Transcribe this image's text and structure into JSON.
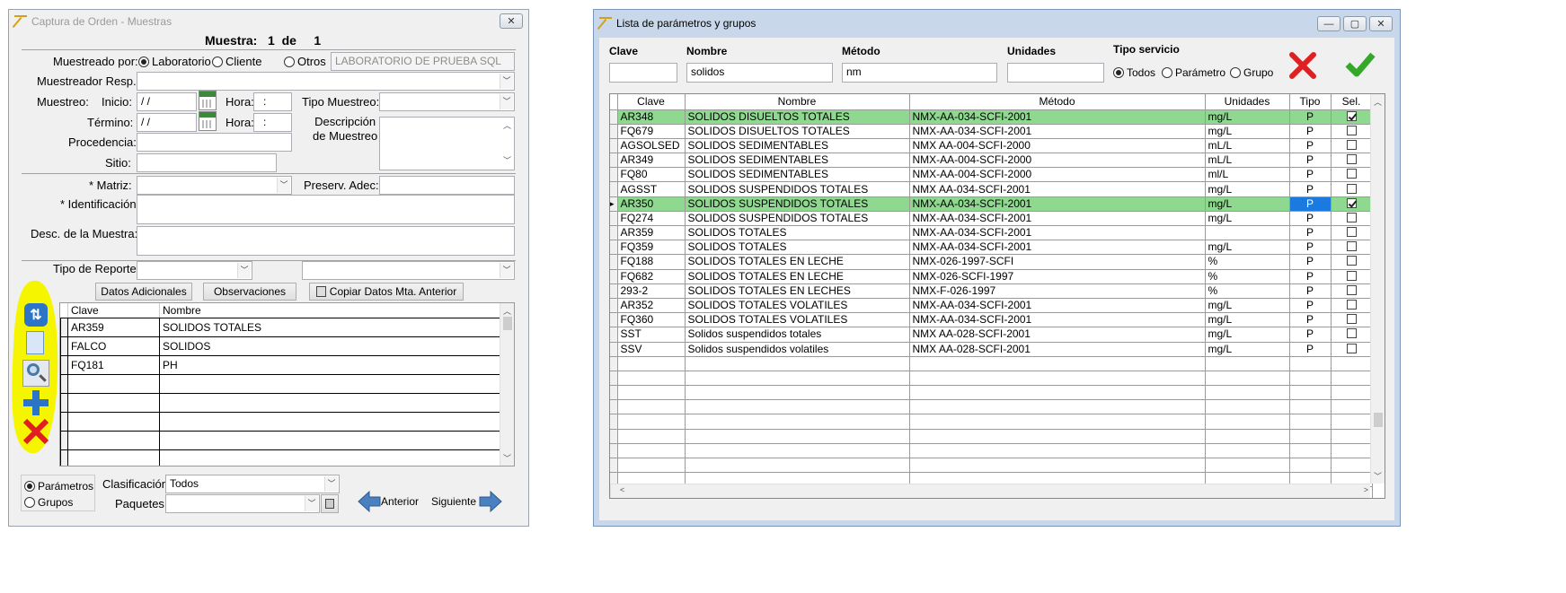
{
  "left": {
    "title": "Captura de Orden - Muestras",
    "muestra": {
      "label": "Muestra:",
      "num": "1",
      "de": "de",
      "total": "1"
    },
    "muestreado_por": {
      "label": "Muestreado por:",
      "opt1": "Laboratorio",
      "opt2": "Cliente",
      "opt3": "Otros",
      "otros_value": "LABORATORIO DE PRUEBA SQL"
    },
    "muestreador_label": "Muestreador Resp.:",
    "muestreo_label": "Muestreo:",
    "inicio_label": "Inicio:",
    "termino_label": "Término:",
    "date_value": "/ /",
    "hora_label": "Hora:",
    "hora_value": ":",
    "tipo_muestreo_label": "Tipo Muestreo:",
    "desc_muestreo_label1": "Descripción",
    "desc_muestreo_label2": "de Muestreo",
    "procedencia_label": "Procedencia:",
    "sitio_label": "Sitio:",
    "matriz_label": "* Matriz:",
    "preserv_label": "Preserv. Adec:",
    "identificacion_label": "* Identificación",
    "desc_muestra_label": "Desc. de la Muestra:",
    "tipo_reporte_label": "Tipo de Reporte:",
    "btn_datos": "Datos Adicionales",
    "btn_obs": "Observaciones",
    "btn_copiar": "Copiar Datos Mta. Anterior",
    "grid_headers": {
      "clave": "Clave",
      "nombre": "Nombre"
    },
    "grid_rows": [
      {
        "clave": "AR359",
        "nombre": "SOLIDOS TOTALES"
      },
      {
        "clave": "FALCO",
        "nombre": "SOLIDOS"
      },
      {
        "clave": "FQ181",
        "nombre": "PH"
      }
    ],
    "radio_param": "Parámetros",
    "radio_grupos": "Grupos",
    "clasificacion_label": "Clasificación",
    "clasificacion_value": "Todos",
    "paquetes_label": "Paquetes",
    "anterior": "Anterior",
    "siguiente": "Siguiente",
    "highlight_color": "#f5f500"
  },
  "right": {
    "title": "Lista de parámetros y grupos",
    "clave_label": "Clave",
    "nombre_label": "Nombre",
    "metodo_label": "Método",
    "unidades_label": "Unidades",
    "tipo_servicio_label": "Tipo servicio",
    "clave_value": "",
    "nombre_value": "solidos",
    "metodo_value": "nm",
    "unidades_value": "",
    "opt_todos": "Todos",
    "opt_parametro": "Parámetro",
    "opt_grupo": "Grupo",
    "headers": {
      "clave": "Clave",
      "nombre": "Nombre",
      "metodo": "Método",
      "unidades": "Unidades",
      "tipo": "Tipo",
      "sel": "Sel."
    },
    "rows": [
      {
        "clave": "AR348",
        "nombre": "SOLIDOS DISUELTOS TOTALES",
        "metodo": "NMX-AA-034-SCFI-2001",
        "unidades": "mg/L",
        "tipo": "P",
        "sel": true
      },
      {
        "clave": "FQ679",
        "nombre": "SOLIDOS DISUELTOS TOTALES",
        "metodo": "NMX-AA-034-SCFI-2001",
        "unidades": "mg/L",
        "tipo": "P",
        "sel": false
      },
      {
        "clave": "AGSOLSED",
        "nombre": "SOLIDOS SEDIMENTABLES",
        "metodo": "NMX AA-004-SCFI-2000",
        "unidades": "mL/L",
        "tipo": "P",
        "sel": false
      },
      {
        "clave": "AR349",
        "nombre": "SOLIDOS SEDIMENTABLES",
        "metodo": "NMX-AA-004-SCFI-2000",
        "unidades": "mL/L",
        "tipo": "P",
        "sel": false
      },
      {
        "clave": "FQ80",
        "nombre": "SOLIDOS SEDIMENTABLES",
        "metodo": "NMX-AA-004-SCFI-2000",
        "unidades": "ml/L",
        "tipo": "P",
        "sel": false
      },
      {
        "clave": "AGSST",
        "nombre": "SOLIDOS SUSPENDIDOS TOTALES",
        "metodo": "NMX AA-034-SCFI-2001",
        "unidades": "mg/L",
        "tipo": "P",
        "sel": false
      },
      {
        "clave": "AR350",
        "nombre": "SOLIDOS SUSPENDIDOS TOTALES",
        "metodo": "NMX-AA-034-SCFI-2001",
        "unidades": "mg/L",
        "tipo": "P",
        "sel": true
      },
      {
        "clave": "FQ274",
        "nombre": "SOLIDOS SUSPENDIDOS TOTALES",
        "metodo": "NMX-AA-034-SCFI-2001",
        "unidades": "mg/L",
        "tipo": "P",
        "sel": false
      },
      {
        "clave": "AR359",
        "nombre": "SOLIDOS TOTALES",
        "metodo": "NMX-AA-034-SCFI-2001",
        "unidades": "",
        "tipo": "P",
        "sel": false
      },
      {
        "clave": "FQ359",
        "nombre": "SOLIDOS TOTALES",
        "metodo": "NMX-AA-034-SCFI-2001",
        "unidades": "mg/L",
        "tipo": "P",
        "sel": false
      },
      {
        "clave": "FQ188",
        "nombre": "SOLIDOS TOTALES EN LECHE",
        "metodo": "NMX-026-1997-SCFI",
        "unidades": "%",
        "tipo": "P",
        "sel": false
      },
      {
        "clave": "FQ682",
        "nombre": "SOLIDOS TOTALES EN LECHE",
        "metodo": "NMX-026-SCFI-1997",
        "unidades": "%",
        "tipo": "P",
        "sel": false
      },
      {
        "clave": "293-2",
        "nombre": "SOLIDOS TOTALES EN LECHES",
        "metodo": "NMX-F-026-1997",
        "unidades": "%",
        "tipo": "P",
        "sel": false
      },
      {
        "clave": "AR352",
        "nombre": "SOLIDOS TOTALES VOLATILES",
        "metodo": "NMX-AA-034-SCFI-2001",
        "unidades": "mg/L",
        "tipo": "P",
        "sel": false
      },
      {
        "clave": "FQ360",
        "nombre": "SOLIDOS TOTALES VOLATILES",
        "metodo": "NMX-AA-034-SCFI-2001",
        "unidades": "mg/L",
        "tipo": "P",
        "sel": false
      },
      {
        "clave": "SST",
        "nombre": "Solidos suspendidos totales",
        "metodo": "NMX AA-028-SCFI-2001",
        "unidades": "mg/L",
        "tipo": "P",
        "sel": false
      },
      {
        "clave": "SSV",
        "nombre": "Solidos suspendidos volatiles",
        "metodo": "NMX AA-028-SCFI-2001",
        "unidades": "mg/L",
        "tipo": "P",
        "sel": false
      }
    ],
    "row_highlight": "#8fd88f",
    "tipo_selected_color": "#1a7ae0"
  }
}
